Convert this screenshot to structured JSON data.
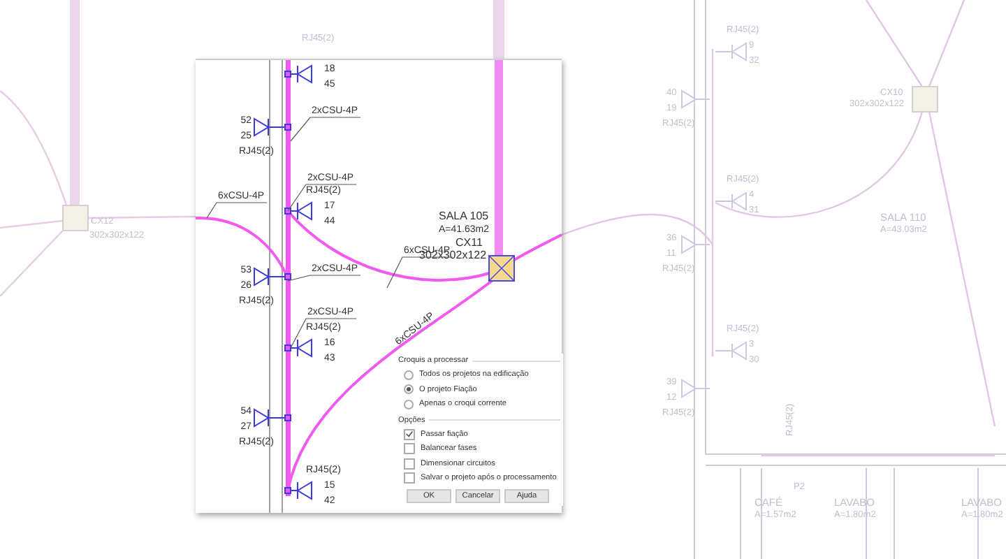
{
  "background": {
    "boxes": [
      {
        "name": "CX12",
        "size": "302x302x122"
      },
      {
        "name": "CX10",
        "size": "302x302x122"
      }
    ],
    "rooms": [
      {
        "name": "SALA 110",
        "area": "A=43.03m2"
      },
      {
        "name": "CAFÉ",
        "area": "A=1.57m2"
      },
      {
        "name": "LAVABO",
        "area": "A=1.80m2"
      },
      {
        "name": "LAVABO",
        "area": "A=1.80m2"
      }
    ],
    "outlets": [
      {
        "kind": "right",
        "type": "RJ45(2)",
        "n1": "9",
        "n2": "32"
      },
      {
        "kind": "left",
        "type": "RJ45(2)",
        "n1": "40",
        "n2": "19"
      },
      {
        "kind": "right",
        "type": "RJ45(2)",
        "n1": "4",
        "n2": "31"
      },
      {
        "kind": "left",
        "type": "RJ45(2)",
        "n1": "36",
        "n2": "11"
      },
      {
        "kind": "right",
        "type": "RJ45(2)",
        "n1": "3",
        "n2": "30"
      },
      {
        "kind": "left",
        "type": "RJ45(2)",
        "n1": "39",
        "n2": "12"
      }
    ],
    "labels": [
      "RJ45(2)",
      "P2",
      "RJ45(2)"
    ]
  },
  "dialog": {
    "preview": {
      "room": {
        "name": "SALA 105",
        "area": "A=41.63m2"
      },
      "box": {
        "name": "CX11",
        "size": "302x302x122"
      },
      "outlets": [
        {
          "kind": "right",
          "n1": "18",
          "n2": "45"
        },
        {
          "kind": "left",
          "type": "RJ45(2)",
          "n1": "52",
          "n2": "25"
        },
        {
          "kind": "right",
          "type": "RJ45(2)",
          "n1": "17",
          "n2": "44"
        },
        {
          "kind": "left",
          "type": "RJ45(2)",
          "n1": "53",
          "n2": "26"
        },
        {
          "kind": "right",
          "type": "RJ45(2)",
          "n1": "16",
          "n2": "43"
        },
        {
          "kind": "left",
          "type": "RJ45(2)",
          "n1": "54",
          "n2": "27"
        },
        {
          "kind": "right",
          "type": "RJ45(2)",
          "n1": "15",
          "n2": "42"
        }
      ],
      "cables": [
        {
          "kind": "leader",
          "label": "2xCSU-4P"
        },
        {
          "kind": "leader",
          "label": "2xCSU-4P"
        },
        {
          "kind": "leader",
          "label": "2xCSU-4P"
        },
        {
          "kind": "leader",
          "label": "2xCSU-4P"
        },
        {
          "kind": "leader",
          "label": "6xCSU-4P"
        },
        {
          "kind": "leader",
          "label": "6xCSU-4P"
        },
        {
          "kind": "along",
          "label": "6xCSU-4P"
        }
      ]
    },
    "scope": {
      "title": "Croquis a processar",
      "options": [
        {
          "label": "Todos os projetos na edificação",
          "selected": false
        },
        {
          "label": "O projeto Fiação",
          "selected": true
        },
        {
          "label": "Apenas o croqui corrente",
          "selected": false
        }
      ]
    },
    "options": {
      "title": "Opções",
      "items": [
        {
          "label": "Passar fiação",
          "checked": true
        },
        {
          "label": "Balancear fases",
          "checked": false
        },
        {
          "label": "Dimensionar circuitos",
          "checked": false
        },
        {
          "label": "Salvar o projeto após o processamento",
          "checked": false
        }
      ]
    },
    "buttons": [
      "OK",
      "Cancelar",
      "Ajuda"
    ]
  }
}
